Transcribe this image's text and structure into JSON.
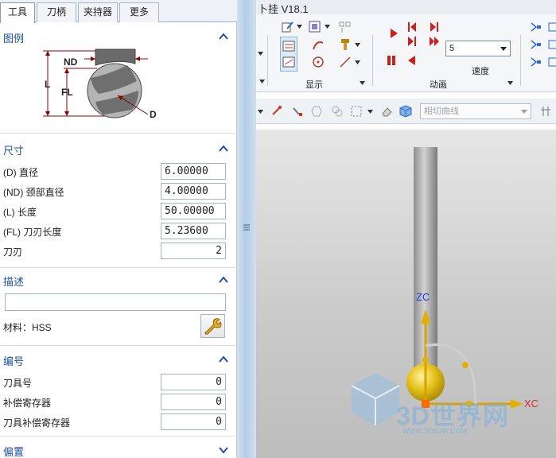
{
  "tabs": [
    "工具",
    "刀柄",
    "夹持器",
    "更多"
  ],
  "legend": {
    "title": "图例",
    "labels": {
      "nd": "ND",
      "l": "L",
      "fl": "FL",
      "d": "D"
    }
  },
  "dimensions": {
    "title": "尺寸",
    "rows": [
      {
        "label": "(D) 直径",
        "value": "6.00000"
      },
      {
        "label": "(ND) 颈部直径",
        "value": "4.00000"
      },
      {
        "label": "(L) 长度",
        "value": "50.00000"
      },
      {
        "label": "(FL) 刀刃长度",
        "value": "5.23600"
      },
      {
        "label": "刀刃",
        "value": "2"
      }
    ]
  },
  "description": {
    "title": "描述",
    "value": "",
    "material_label": "材料：HSS"
  },
  "numbering": {
    "title": "编号",
    "rows": [
      {
        "label": "刀具号",
        "value": "0"
      },
      {
        "label": "补偿寄存器",
        "value": "0"
      },
      {
        "label": "刀具补偿寄存器",
        "value": "0"
      }
    ]
  },
  "offset": {
    "title": "偏置"
  },
  "app": {
    "title": "卜挂 V18.1"
  },
  "ribbon": {
    "group_display": "显示",
    "group_animation": "动画",
    "speed_value": "5",
    "speed_label": "速度"
  },
  "toolbar": {
    "curve_select": "相切曲线"
  },
  "viewport": {
    "axis_zc": "ZC",
    "axis_xc": "XC",
    "watermark": "3D世界网",
    "watermark_url": "WWW.3DSJW.COM"
  },
  "colors": {
    "section_title": "#1e4fa3",
    "axis_label_blue": "#1f3fd6",
    "axis_label_red": "#e0262a",
    "tool_ball": "#e4c21a"
  },
  "icons": [
    "chevron-up-icon",
    "chevron-down-icon",
    "wrench-icon",
    "play-icon",
    "step-icon",
    "pause-icon",
    "dropdown-arrow-icon"
  ]
}
